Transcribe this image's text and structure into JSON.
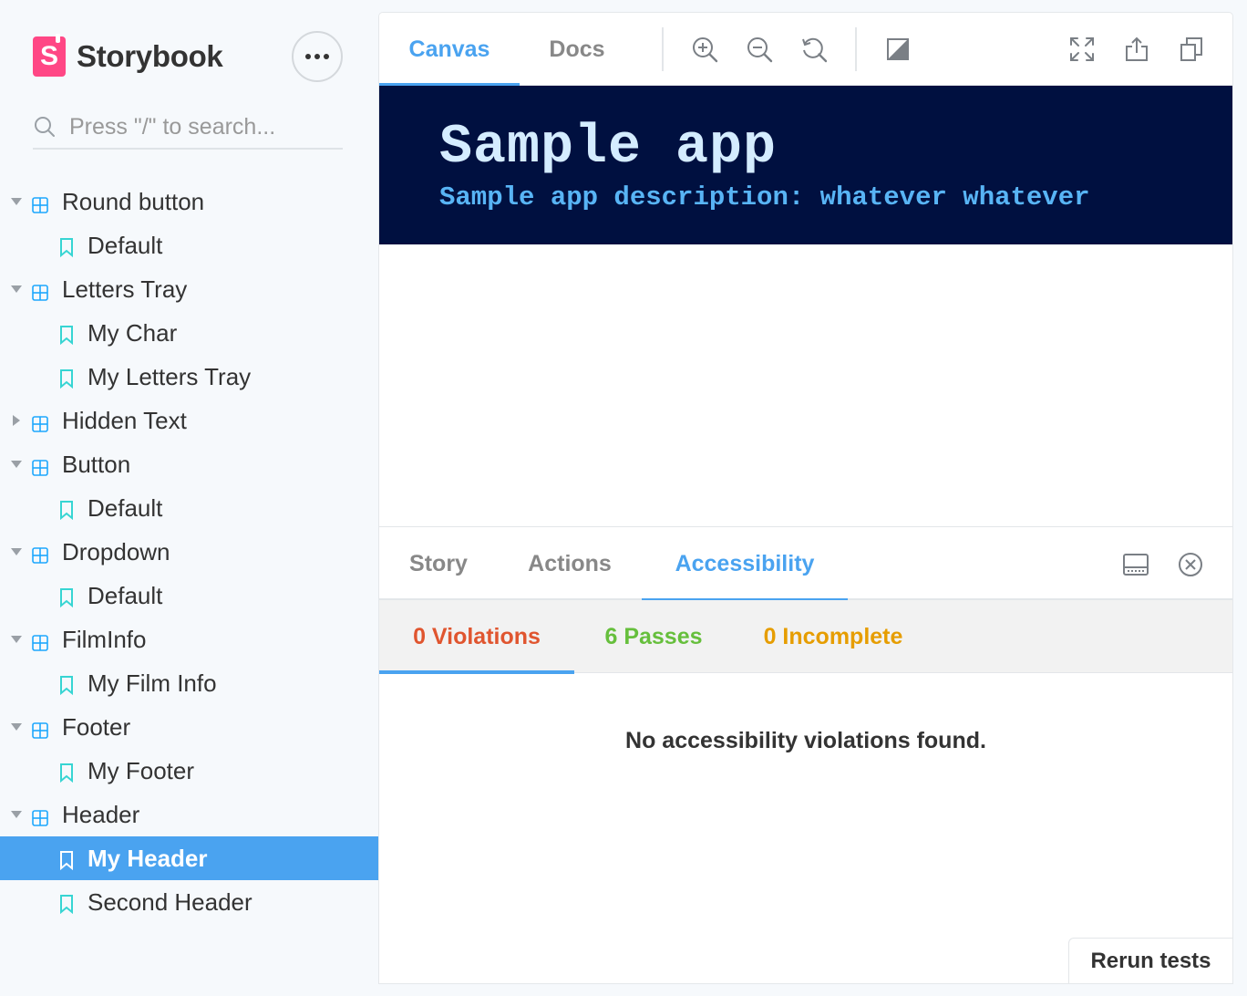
{
  "brand": {
    "name": "Storybook",
    "logo_letter": "S",
    "logo_color": "#ff4785"
  },
  "search": {
    "placeholder": "Press \"/\" to search..."
  },
  "tree": {
    "items": [
      {
        "label": "Round button",
        "type": "component",
        "expanded": true
      },
      {
        "label": "Default",
        "type": "story"
      },
      {
        "label": "Letters Tray",
        "type": "component",
        "expanded": true
      },
      {
        "label": "My Char",
        "type": "story"
      },
      {
        "label": "My Letters Tray",
        "type": "story"
      },
      {
        "label": "Hidden Text",
        "type": "component",
        "expanded": false
      },
      {
        "label": "Button",
        "type": "component",
        "expanded": true
      },
      {
        "label": "Default",
        "type": "story"
      },
      {
        "label": "Dropdown",
        "type": "component",
        "expanded": true
      },
      {
        "label": "Default",
        "type": "story"
      },
      {
        "label": "FilmInfo",
        "type": "component",
        "expanded": true
      },
      {
        "label": "My Film Info",
        "type": "story"
      },
      {
        "label": "Footer",
        "type": "component",
        "expanded": true
      },
      {
        "label": "My Footer",
        "type": "story"
      },
      {
        "label": "Header",
        "type": "component",
        "expanded": true
      },
      {
        "label": "My Header",
        "type": "story",
        "selected": true
      },
      {
        "label": "Second Header",
        "type": "story"
      }
    ]
  },
  "toolbar": {
    "tabs": [
      {
        "label": "Canvas",
        "active": true
      },
      {
        "label": "Docs",
        "active": false
      }
    ],
    "tools": [
      "zoom-in-icon",
      "zoom-out-icon",
      "zoom-reset-icon",
      "background-icon"
    ],
    "right_tools": [
      "fullscreen-icon",
      "share-icon",
      "copy-icon"
    ]
  },
  "preview": {
    "title": "Sample app",
    "description": "Sample app description: whatever whatever",
    "background": "#001040"
  },
  "addons": {
    "tabs": [
      {
        "label": "Story",
        "active": false
      },
      {
        "label": "Actions",
        "active": false
      },
      {
        "label": "Accessibility",
        "active": true
      }
    ],
    "results": {
      "violations": "0 Violations",
      "passes": "6 Passes",
      "incomplete": "0 Incomplete",
      "message": "No accessibility violations found.",
      "rerun_label": "Rerun tests"
    }
  },
  "colors": {
    "accent": "#4aa3f0",
    "violations": "#e0552f",
    "passes": "#66bf3c",
    "incomplete": "#e69d00",
    "story_icon": "#37d5d3",
    "component_icon": "#1ea7fd"
  }
}
